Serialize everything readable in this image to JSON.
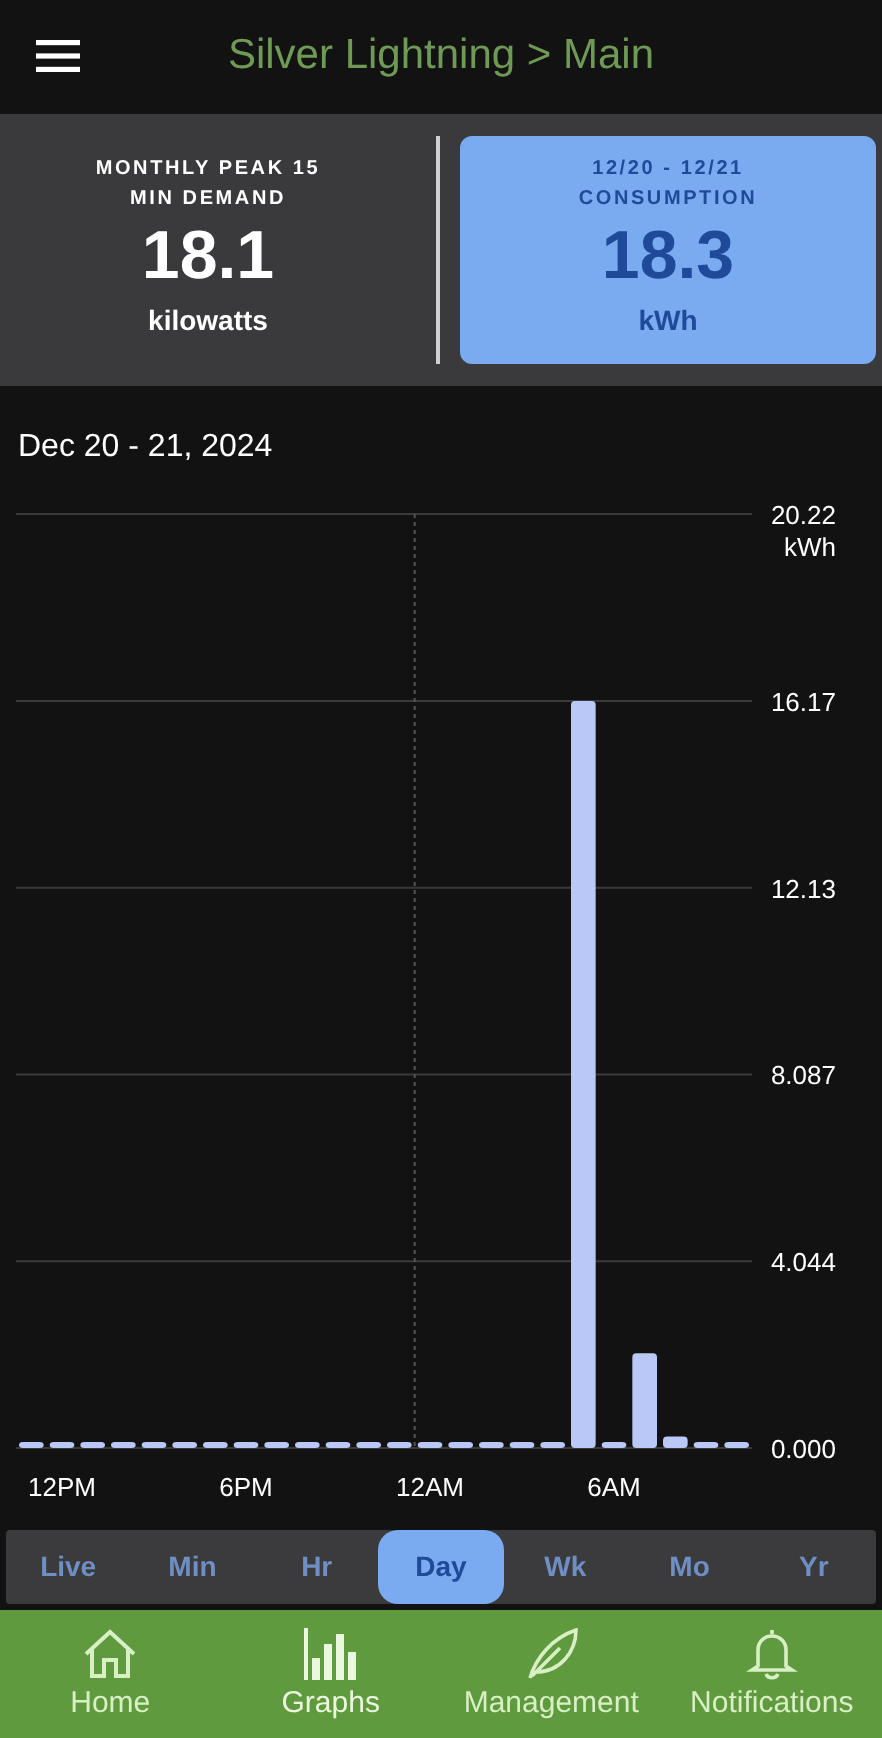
{
  "header": {
    "title": "Silver Lightning > Main"
  },
  "summary_cards": [
    {
      "label": "MONTHLY PEAK 15 MIN DEMAND",
      "value": "18.1",
      "unit": "kilowatts",
      "selected": false
    },
    {
      "label": "12/20 - 12/21 CONSUMPTION",
      "value": "18.3",
      "unit": "kWh",
      "selected": true
    }
  ],
  "chart": {
    "title": "Dec 20 - 21, 2024",
    "chart_data": {
      "type": "bar",
      "ylabel": "kWh",
      "categories": [
        null,
        "12PM",
        null,
        null,
        null,
        null,
        null,
        "6PM",
        null,
        null,
        null,
        null,
        null,
        "12AM",
        null,
        null,
        null,
        null,
        null,
        "6AM",
        null,
        null,
        null,
        null
      ],
      "series": [
        {
          "color": "#b9c8f7",
          "values": [
            0.05,
            0.05,
            0.05,
            0.05,
            0.05,
            0.05,
            0.05,
            0.05,
            0.05,
            0.05,
            0.05,
            0.05,
            0.05,
            0.05,
            0.05,
            0.05,
            0.05,
            0.05,
            16.17,
            0.05,
            2.05,
            0.25,
            0.05,
            0.05
          ]
        }
      ],
      "ylim": [
        0,
        20.22
      ],
      "yticks": [
        {
          "value": 0,
          "label": "0.000"
        },
        {
          "value": 4.044,
          "label": "4.044"
        },
        {
          "value": 8.087,
          "label": "8.087"
        },
        {
          "value": 12.13,
          "label": "12.13"
        },
        {
          "value": 16.17,
          "label": "16.17"
        },
        {
          "value": 20.22,
          "label": "20.22"
        }
      ],
      "grid": true
    }
  },
  "period_tabs": [
    {
      "label": "Live",
      "selected": false
    },
    {
      "label": "Min",
      "selected": false
    },
    {
      "label": "Hr",
      "selected": false
    },
    {
      "label": "Day",
      "selected": true
    },
    {
      "label": "Wk",
      "selected": false
    },
    {
      "label": "Mo",
      "selected": false
    },
    {
      "label": "Yr",
      "selected": false
    }
  ],
  "bottom_nav": [
    {
      "kind": "home",
      "label": "Home",
      "selected": false
    },
    {
      "kind": "graphs",
      "label": "Graphs",
      "selected": true
    },
    {
      "kind": "leaf",
      "label": "Management",
      "selected": false
    },
    {
      "kind": "bell",
      "label": "Notifications",
      "selected": false
    }
  ]
}
